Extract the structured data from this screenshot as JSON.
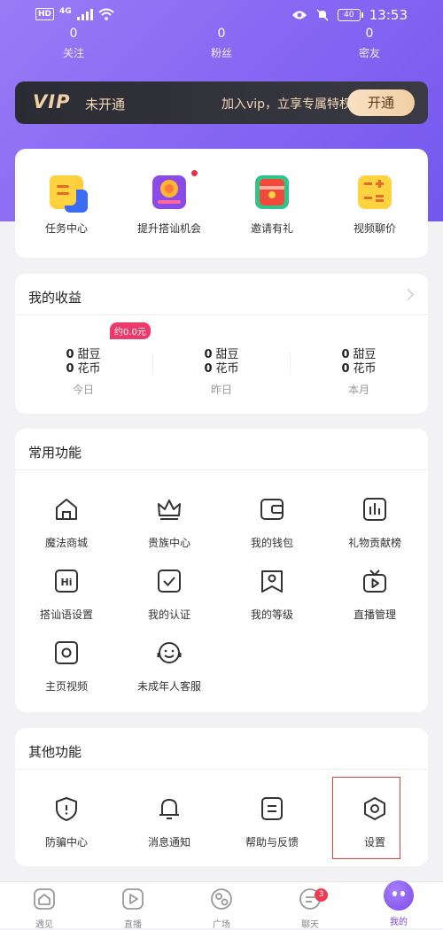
{
  "status_bar": {
    "hd": "HD",
    "network": "4G",
    "time": "13:53",
    "battery": "40"
  },
  "stats": [
    {
      "count": "0",
      "label": "关注"
    },
    {
      "count": "0",
      "label": "粉丝"
    },
    {
      "count": "0",
      "label": "密友"
    }
  ],
  "vip": {
    "logo": "VIP",
    "status": "未开通",
    "desc": "加入vip，立享专属特权",
    "button": "开通"
  },
  "quick_actions": [
    {
      "label": "任务中心",
      "icon": "task-center-icon"
    },
    {
      "label": "提升搭讪机会",
      "icon": "boost-chat-icon"
    },
    {
      "label": "邀请有礼",
      "icon": "invite-gift-icon"
    },
    {
      "label": "视频聊价",
      "icon": "video-price-icon"
    }
  ],
  "earnings": {
    "title": "我的收益",
    "badge": "约0.0元",
    "columns": [
      {
        "beans": "0",
        "beans_unit": "甜豆",
        "coins": "0",
        "coins_unit": "花币",
        "label": "今日"
      },
      {
        "beans": "0",
        "beans_unit": "甜豆",
        "coins": "0",
        "coins_unit": "花币",
        "label": "昨日"
      },
      {
        "beans": "0",
        "beans_unit": "甜豆",
        "coins": "0",
        "coins_unit": "花币",
        "label": "本月"
      }
    ]
  },
  "common": {
    "title": "常用功能",
    "items": [
      {
        "label": "魔法商城",
        "icon": "home-icon"
      },
      {
        "label": "贵族中心",
        "icon": "crown-icon"
      },
      {
        "label": "我的钱包",
        "icon": "wallet-icon"
      },
      {
        "label": "礼物贡献榜",
        "icon": "bar-chart-icon"
      },
      {
        "label": "搭讪语设置",
        "icon": "hi-icon"
      },
      {
        "label": "我的认证",
        "icon": "verified-icon"
      },
      {
        "label": "我的等级",
        "icon": "level-icon"
      },
      {
        "label": "直播管理",
        "icon": "tv-icon"
      },
      {
        "label": "主页视频",
        "icon": "video-icon"
      },
      {
        "label": "未成年人客服",
        "icon": "headset-icon"
      }
    ]
  },
  "other": {
    "title": "其他功能",
    "items": [
      {
        "label": "防骗中心",
        "icon": "shield-icon"
      },
      {
        "label": "消息通知",
        "icon": "bell-icon"
      },
      {
        "label": "帮助与反馈",
        "icon": "feedback-icon"
      },
      {
        "label": "设置",
        "icon": "settings-icon"
      }
    ]
  },
  "nav": [
    {
      "label": "遇见",
      "icon": "meet-icon"
    },
    {
      "label": "直播",
      "icon": "live-icon"
    },
    {
      "label": "广场",
      "icon": "plaza-icon"
    },
    {
      "label": "聊天",
      "icon": "chat-icon",
      "badge": "3"
    },
    {
      "label": "我的",
      "icon": "me-icon"
    }
  ],
  "colors": {
    "accent": "#8868f3",
    "vip_bg": "#2b2b33",
    "vip_gold": "#f3d9b5",
    "badge_pink": "#ee3a6a",
    "highlight": "#e0403a"
  }
}
